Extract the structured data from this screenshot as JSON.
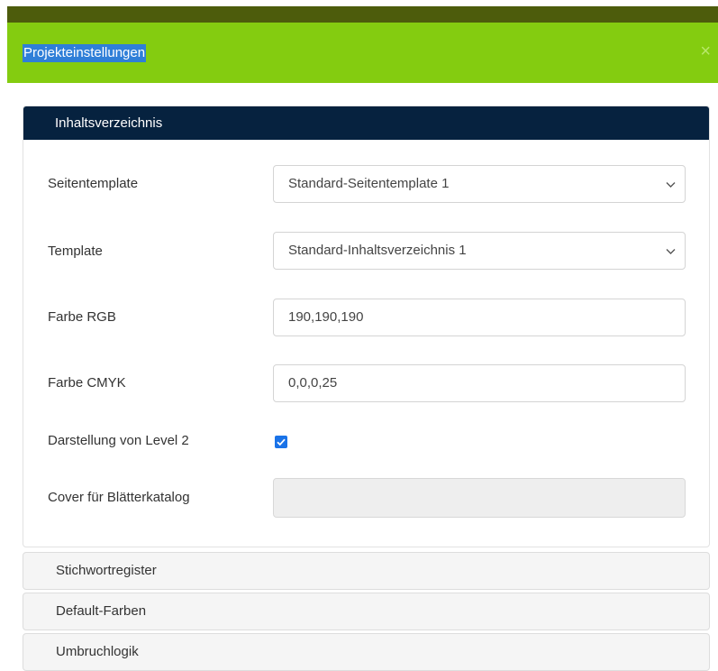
{
  "modal": {
    "title": "Projekteinstellungen",
    "close_label": "×"
  },
  "panel": {
    "heading": "Inhaltsverzeichnis",
    "fields": {
      "seitentemplate": {
        "label": "Seitentemplate",
        "value": "Standard-Seitentemplate 1"
      },
      "template": {
        "label": "Template",
        "value": "Standard-Inhaltsverzeichnis 1"
      },
      "farbe_rgb": {
        "label": "Farbe RGB",
        "value": "190,190,190"
      },
      "farbe_cmyk": {
        "label": "Farbe CMYK",
        "value": "0,0,0,25"
      },
      "level2": {
        "label": "Darstellung von Level 2",
        "checked": true
      },
      "cover": {
        "label": "Cover für Blätterkatalog",
        "value": ""
      }
    }
  },
  "accordion": [
    {
      "label": "Stichwortregister"
    },
    {
      "label": "Default-Farben"
    },
    {
      "label": "Umbruchlogik"
    }
  ],
  "colors": {
    "header_bg": "#84cc10",
    "topbar_bg": "#4d5c0c",
    "panel_heading_bg": "#06223f",
    "checkbox": "#1a73e8"
  },
  "icons": {
    "close": "close-icon",
    "dropdown": "chevron-down-icon",
    "check": "check-icon"
  }
}
